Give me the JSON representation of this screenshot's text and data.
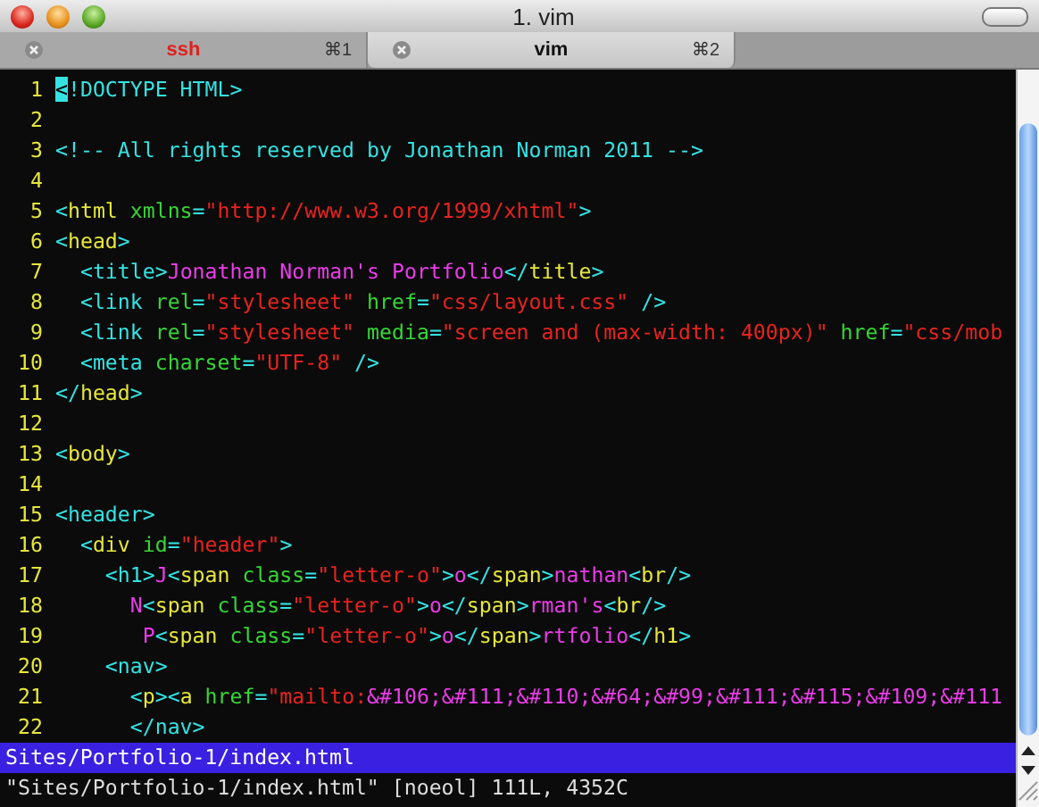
{
  "window": {
    "title": "1. vim"
  },
  "tabs": [
    {
      "label": "ssh",
      "shortcut": "⌘1",
      "selected": false,
      "activity": true
    },
    {
      "label": "vim",
      "shortcut": "⌘2",
      "selected": true,
      "activity": false
    }
  ],
  "editor": {
    "lines": [
      {
        "number": "1",
        "segments": [
          {
            "kind": "cursor",
            "text": "<"
          },
          {
            "kind": "bracket",
            "text": "!DOCTYPE HTML>"
          }
        ]
      },
      {
        "number": "2"
      },
      {
        "number": "3",
        "segments": [
          {
            "kind": "comment",
            "text": "<!-- All rights reserved by Jonathan Norman 2011 -->"
          }
        ]
      },
      {
        "number": "4"
      },
      {
        "number": "5",
        "segments": [
          {
            "kind": "bracket",
            "text": "<"
          },
          {
            "kind": "name",
            "text": "html"
          },
          {
            "kind": "attr",
            "text": " xmlns"
          },
          {
            "kind": "bracket",
            "text": "="
          },
          {
            "kind": "string",
            "text": "\"http://www.w3.org/1999/xhtml\""
          },
          {
            "kind": "bracket",
            "text": ">"
          }
        ]
      },
      {
        "number": "6",
        "segments": [
          {
            "kind": "bracket",
            "text": "<"
          },
          {
            "kind": "name",
            "text": "head"
          },
          {
            "kind": "bracket",
            "text": ">"
          }
        ]
      },
      {
        "number": "7",
        "segments": [
          {
            "kind": "bracket",
            "text": "  <"
          },
          {
            "kind": "tag",
            "text": "title"
          },
          {
            "kind": "bracket",
            "text": ">"
          },
          {
            "kind": "text",
            "text": "Jonathan Norman's Portfolio"
          },
          {
            "kind": "bracket",
            "text": "</"
          },
          {
            "kind": "name",
            "text": "title"
          },
          {
            "kind": "bracket",
            "text": ">"
          }
        ]
      },
      {
        "number": "8",
        "segments": [
          {
            "kind": "bracket",
            "text": "  <"
          },
          {
            "kind": "tag",
            "text": "link"
          },
          {
            "kind": "attr",
            "text": " rel"
          },
          {
            "kind": "bracket",
            "text": "="
          },
          {
            "kind": "string",
            "text": "\"stylesheet\""
          },
          {
            "kind": "attr",
            "text": " href"
          },
          {
            "kind": "bracket",
            "text": "="
          },
          {
            "kind": "string",
            "text": "\"css/layout.css\""
          },
          {
            "kind": "bracket",
            "text": " />"
          }
        ]
      },
      {
        "number": "9",
        "segments": [
          {
            "kind": "bracket",
            "text": "  <"
          },
          {
            "kind": "tag",
            "text": "link"
          },
          {
            "kind": "attr",
            "text": " rel"
          },
          {
            "kind": "bracket",
            "text": "="
          },
          {
            "kind": "string",
            "text": "\"stylesheet\""
          },
          {
            "kind": "attr",
            "text": " media"
          },
          {
            "kind": "bracket",
            "text": "="
          },
          {
            "kind": "string",
            "text": "\"screen and (max-width: 400px)\""
          },
          {
            "kind": "attr",
            "text": " href"
          },
          {
            "kind": "bracket",
            "text": "="
          },
          {
            "kind": "string",
            "text": "\"css/mob"
          }
        ]
      },
      {
        "number": "10",
        "segments": [
          {
            "kind": "bracket",
            "text": "  <"
          },
          {
            "kind": "tag",
            "text": "meta"
          },
          {
            "kind": "attr",
            "text": " charset"
          },
          {
            "kind": "bracket",
            "text": "="
          },
          {
            "kind": "string",
            "text": "\"UTF-8\""
          },
          {
            "kind": "bracket",
            "text": " />"
          }
        ]
      },
      {
        "number": "11",
        "segments": [
          {
            "kind": "bracket",
            "text": "</"
          },
          {
            "kind": "name",
            "text": "head"
          },
          {
            "kind": "bracket",
            "text": ">"
          }
        ]
      },
      {
        "number": "12"
      },
      {
        "number": "13",
        "segments": [
          {
            "kind": "bracket",
            "text": "<"
          },
          {
            "kind": "name",
            "text": "body"
          },
          {
            "kind": "bracket",
            "text": ">"
          }
        ]
      },
      {
        "number": "14"
      },
      {
        "number": "15",
        "segments": [
          {
            "kind": "bracket",
            "text": "<"
          },
          {
            "kind": "tag",
            "text": "header"
          },
          {
            "kind": "bracket",
            "text": ">"
          }
        ]
      },
      {
        "number": "16",
        "segments": [
          {
            "kind": "bracket",
            "text": "  <"
          },
          {
            "kind": "name",
            "text": "div"
          },
          {
            "kind": "attr",
            "text": " id"
          },
          {
            "kind": "bracket",
            "text": "="
          },
          {
            "kind": "string",
            "text": "\"header\""
          },
          {
            "kind": "bracket",
            "text": ">"
          }
        ]
      },
      {
        "number": "17",
        "segments": [
          {
            "kind": "bracket",
            "text": "    <"
          },
          {
            "kind": "tag",
            "text": "h1"
          },
          {
            "kind": "bracket",
            "text": ">"
          },
          {
            "kind": "text",
            "text": "J"
          },
          {
            "kind": "bracket",
            "text": "<"
          },
          {
            "kind": "name",
            "text": "span"
          },
          {
            "kind": "attr",
            "text": " class"
          },
          {
            "kind": "bracket",
            "text": "="
          },
          {
            "kind": "string",
            "text": "\"letter-o\""
          },
          {
            "kind": "bracket",
            "text": ">"
          },
          {
            "kind": "text",
            "text": "o"
          },
          {
            "kind": "bracket",
            "text": "</"
          },
          {
            "kind": "name",
            "text": "span"
          },
          {
            "kind": "bracket",
            "text": ">"
          },
          {
            "kind": "text",
            "text": "nathan"
          },
          {
            "kind": "bracket",
            "text": "<"
          },
          {
            "kind": "name",
            "text": "br"
          },
          {
            "kind": "bracket",
            "text": "/>"
          }
        ]
      },
      {
        "number": "18",
        "segments": [
          {
            "kind": "text",
            "text": "      N"
          },
          {
            "kind": "bracket",
            "text": "<"
          },
          {
            "kind": "name",
            "text": "span"
          },
          {
            "kind": "attr",
            "text": " class"
          },
          {
            "kind": "bracket",
            "text": "="
          },
          {
            "kind": "string",
            "text": "\"letter-o\""
          },
          {
            "kind": "bracket",
            "text": ">"
          },
          {
            "kind": "text",
            "text": "o"
          },
          {
            "kind": "bracket",
            "text": "</"
          },
          {
            "kind": "name",
            "text": "span"
          },
          {
            "kind": "bracket",
            "text": ">"
          },
          {
            "kind": "text",
            "text": "rman's"
          },
          {
            "kind": "bracket",
            "text": "<"
          },
          {
            "kind": "name",
            "text": "br"
          },
          {
            "kind": "bracket",
            "text": "/>"
          }
        ]
      },
      {
        "number": "19",
        "segments": [
          {
            "kind": "text",
            "text": "       P"
          },
          {
            "kind": "bracket",
            "text": "<"
          },
          {
            "kind": "name",
            "text": "span"
          },
          {
            "kind": "attr",
            "text": " class"
          },
          {
            "kind": "bracket",
            "text": "="
          },
          {
            "kind": "string",
            "text": "\"letter-o\""
          },
          {
            "kind": "bracket",
            "text": ">"
          },
          {
            "kind": "text",
            "text": "o"
          },
          {
            "kind": "bracket",
            "text": "</"
          },
          {
            "kind": "name",
            "text": "span"
          },
          {
            "kind": "bracket",
            "text": ">"
          },
          {
            "kind": "text",
            "text": "rtfolio"
          },
          {
            "kind": "bracket",
            "text": "</"
          },
          {
            "kind": "name",
            "text": "h1"
          },
          {
            "kind": "bracket",
            "text": ">"
          }
        ]
      },
      {
        "number": "20",
        "segments": [
          {
            "kind": "bracket",
            "text": "    <"
          },
          {
            "kind": "tag",
            "text": "nav"
          },
          {
            "kind": "bracket",
            "text": ">"
          }
        ]
      },
      {
        "number": "21",
        "segments": [
          {
            "kind": "bracket",
            "text": "      <"
          },
          {
            "kind": "name",
            "text": "p"
          },
          {
            "kind": "bracket",
            "text": "><"
          },
          {
            "kind": "name",
            "text": "a"
          },
          {
            "kind": "attr",
            "text": " href"
          },
          {
            "kind": "bracket",
            "text": "="
          },
          {
            "kind": "string",
            "text": "\"mailto:"
          },
          {
            "kind": "text",
            "text": "&#106;&#111;&#110;&#64;&#99;&#111;&#115;&#109;&#111"
          }
        ]
      },
      {
        "number": "22",
        "segments": [
          {
            "kind": "bracket",
            "text": "      </"
          },
          {
            "kind": "tag",
            "text": "nav"
          },
          {
            "kind": "bracket",
            "text": ">"
          }
        ]
      }
    ]
  },
  "status_line": "Sites/Portfolio-1/index.html",
  "message": "\"Sites/Portfolio-1/index.html\" [noeol] 111L, 4352C"
}
